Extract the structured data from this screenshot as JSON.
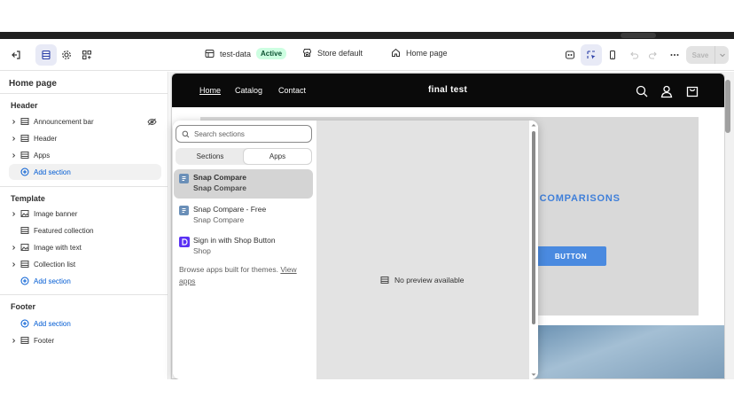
{
  "toolbar": {
    "theme_name": "test-data",
    "theme_status": "Active",
    "store_template": "Store default",
    "page_selector": "Home page",
    "save_label": "Save"
  },
  "sidebar": {
    "title": "Home page",
    "groups": {
      "header": "Header",
      "template": "Template",
      "footer": "Footer"
    },
    "header_items": [
      "Announcement bar",
      "Header",
      "Apps"
    ],
    "template_items": [
      "Image banner",
      "Featured collection",
      "Image with text",
      "Collection list"
    ],
    "footer_items": [
      "Footer"
    ],
    "add_section_label": "Add section"
  },
  "store": {
    "nav": [
      "Home",
      "Catalog",
      "Contact"
    ],
    "brand": "final test",
    "banner_heading_partial": "C COMPARISONS",
    "banner_button": "BUTTON"
  },
  "picker": {
    "search_placeholder": "Search sections",
    "tabs": [
      "Sections",
      "Apps"
    ],
    "selected_tab": "Apps",
    "apps": [
      {
        "name": "Snap Compare",
        "developer": "Snap Compare",
        "icon": "app-block-icon",
        "icon_color": "#6a8fb8"
      },
      {
        "name": "Snap Compare - Free",
        "developer": "Snap Compare",
        "icon": "app-block-icon",
        "icon_color": "#6a8fb8"
      },
      {
        "name": "Sign in with Shop Button",
        "developer": "Shop",
        "icon": "shop-d-icon",
        "icon_color": "#5a31f4"
      }
    ],
    "browse_text": "Browse apps built for themes.",
    "browse_link": "View apps",
    "no_preview": "No preview available"
  },
  "colors": {
    "accent": "#005bd3",
    "active_badge_bg": "#cdfee1",
    "banner_text": "#3f7fd9"
  }
}
